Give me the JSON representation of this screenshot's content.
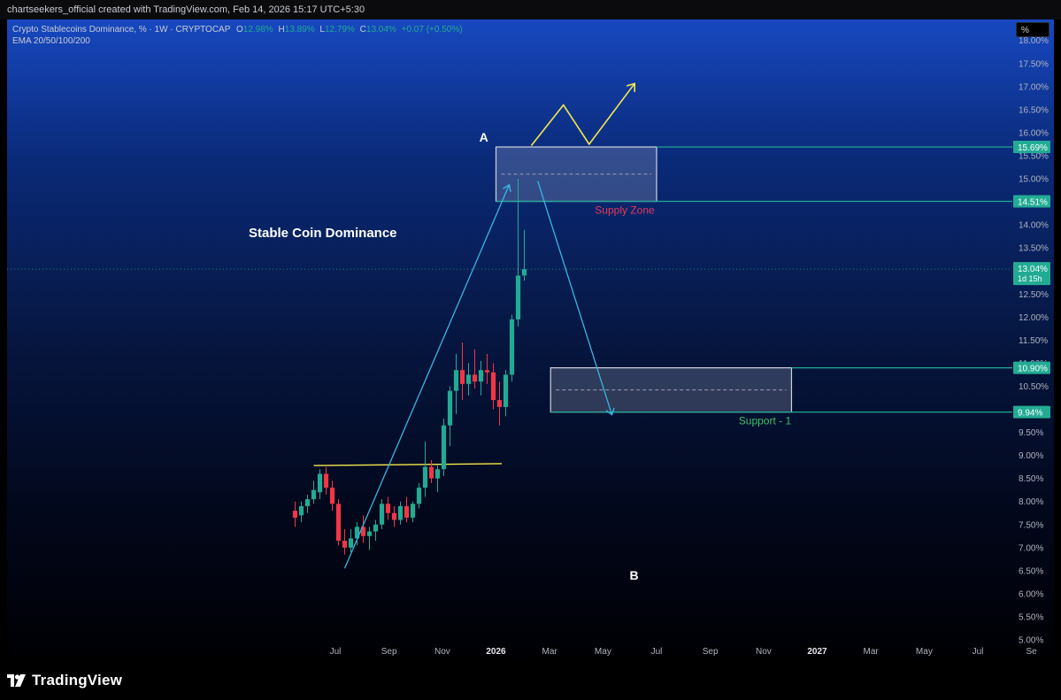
{
  "header": {
    "attribution": "chartseekers_official created with TradingView.com, Feb 14, 2026 15:17 UTC+5:30"
  },
  "legend": {
    "symbol": "Crypto Stablecoins Dominance, % · 1W · CRYPTOCAP",
    "o_label": "O",
    "o_value": "12.98%",
    "h_label": "H",
    "h_value": "13.89%",
    "l_label": "L",
    "l_value": "12.79%",
    "c_label": "C",
    "c_value": "13.04%",
    "change": "+0.07 (+0.50%)",
    "indicator": "EMA 20/50/100/200"
  },
  "scale_unit": "%",
  "brand": {
    "name": "TradingView"
  },
  "colors": {
    "up": "#22ab94",
    "down": "#f23645",
    "accent": "#22ab94",
    "arrow": "#38b6e0",
    "yellow": "#f5e94a"
  },
  "chart_data": {
    "type": "candlestick",
    "title": "Stable Coin Dominance",
    "ylim": [
      5.0,
      18.5
    ],
    "y_ticks": [
      "5.00%",
      "5.50%",
      "6.00%",
      "6.50%",
      "7.00%",
      "7.50%",
      "8.00%",
      "8.50%",
      "9.00%",
      "9.50%",
      "10.00%",
      "10.50%",
      "11.00%",
      "11.50%",
      "12.00%",
      "12.50%",
      "13.00%",
      "13.50%",
      "14.00%",
      "14.50%",
      "15.00%",
      "15.50%",
      "16.00%",
      "16.50%",
      "17.00%",
      "17.50%",
      "18.00%"
    ],
    "x_ticks": [
      {
        "label": "Jul",
        "t": 2025.5,
        "bold": false
      },
      {
        "label": "Sep",
        "t": 2025.667,
        "bold": false
      },
      {
        "label": "Nov",
        "t": 2025.833,
        "bold": false
      },
      {
        "label": "2026",
        "t": 2026.0,
        "bold": true
      },
      {
        "label": "Mar",
        "t": 2026.167,
        "bold": false
      },
      {
        "label": "May",
        "t": 2026.333,
        "bold": false
      },
      {
        "label": "Jul",
        "t": 2026.5,
        "bold": false
      },
      {
        "label": "Sep",
        "t": 2026.667,
        "bold": false
      },
      {
        "label": "Nov",
        "t": 2026.833,
        "bold": false
      },
      {
        "label": "2027",
        "t": 2027.0,
        "bold": true
      },
      {
        "label": "Mar",
        "t": 2027.167,
        "bold": false
      },
      {
        "label": "May",
        "t": 2027.333,
        "bold": false
      },
      {
        "label": "Jul",
        "t": 2027.5,
        "bold": false
      },
      {
        "label": "Se",
        "t": 2027.667,
        "bold": false
      }
    ],
    "candles": [
      {
        "o": 7.8,
        "h": 8.0,
        "l": 7.45,
        "c": 7.65
      },
      {
        "o": 7.7,
        "h": 8.0,
        "l": 7.55,
        "c": 7.9
      },
      {
        "o": 7.9,
        "h": 8.15,
        "l": 7.75,
        "c": 8.05
      },
      {
        "o": 8.05,
        "h": 8.45,
        "l": 7.95,
        "c": 8.25
      },
      {
        "o": 8.2,
        "h": 8.7,
        "l": 8.05,
        "c": 8.6
      },
      {
        "o": 8.6,
        "h": 8.75,
        "l": 8.15,
        "c": 8.3
      },
      {
        "o": 8.3,
        "h": 8.45,
        "l": 7.8,
        "c": 7.95
      },
      {
        "o": 7.95,
        "h": 8.05,
        "l": 7.05,
        "c": 7.15
      },
      {
        "o": 7.15,
        "h": 7.4,
        "l": 6.85,
        "c": 7.0
      },
      {
        "o": 7.0,
        "h": 7.4,
        "l": 6.9,
        "c": 7.2
      },
      {
        "o": 7.2,
        "h": 7.55,
        "l": 7.05,
        "c": 7.45
      },
      {
        "o": 7.45,
        "h": 7.7,
        "l": 7.1,
        "c": 7.25
      },
      {
        "o": 7.25,
        "h": 7.45,
        "l": 6.95,
        "c": 7.35
      },
      {
        "o": 7.35,
        "h": 7.6,
        "l": 7.15,
        "c": 7.5
      },
      {
        "o": 7.5,
        "h": 8.05,
        "l": 7.4,
        "c": 7.95
      },
      {
        "o": 7.95,
        "h": 8.1,
        "l": 7.6,
        "c": 7.75
      },
      {
        "o": 7.75,
        "h": 7.9,
        "l": 7.45,
        "c": 7.6
      },
      {
        "o": 7.6,
        "h": 8.0,
        "l": 7.5,
        "c": 7.9
      },
      {
        "o": 7.9,
        "h": 8.1,
        "l": 7.55,
        "c": 7.65
      },
      {
        "o": 7.65,
        "h": 8.0,
        "l": 7.55,
        "c": 7.95
      },
      {
        "o": 7.95,
        "h": 8.4,
        "l": 7.85,
        "c": 8.3
      },
      {
        "o": 8.3,
        "h": 9.3,
        "l": 8.1,
        "c": 8.75
      },
      {
        "o": 8.75,
        "h": 8.9,
        "l": 8.4,
        "c": 8.5
      },
      {
        "o": 8.5,
        "h": 8.8,
        "l": 8.2,
        "c": 8.7
      },
      {
        "o": 8.7,
        "h": 9.8,
        "l": 8.55,
        "c": 9.65
      },
      {
        "o": 9.65,
        "h": 10.5,
        "l": 9.2,
        "c": 10.4
      },
      {
        "o": 10.4,
        "h": 11.2,
        "l": 9.9,
        "c": 10.85
      },
      {
        "o": 10.85,
        "h": 11.45,
        "l": 10.2,
        "c": 10.55
      },
      {
        "o": 10.55,
        "h": 11.0,
        "l": 10.3,
        "c": 10.75
      },
      {
        "o": 10.75,
        "h": 11.3,
        "l": 10.45,
        "c": 10.6
      },
      {
        "o": 10.6,
        "h": 11.05,
        "l": 10.3,
        "c": 10.85
      },
      {
        "o": 10.85,
        "h": 11.2,
        "l": 10.55,
        "c": 10.8
      },
      {
        "o": 10.8,
        "h": 11.0,
        "l": 10.0,
        "c": 10.2
      },
      {
        "o": 10.2,
        "h": 10.6,
        "l": 9.65,
        "c": 10.05
      },
      {
        "o": 10.05,
        "h": 10.85,
        "l": 9.85,
        "c": 10.75
      },
      {
        "o": 10.75,
        "h": 12.05,
        "l": 10.6,
        "c": 11.95
      },
      {
        "o": 11.95,
        "h": 15.0,
        "l": 11.8,
        "c": 12.9
      },
      {
        "o": 12.9,
        "h": 13.89,
        "l": 12.79,
        "c": 13.04
      }
    ],
    "horizontal_line": {
      "from_index": 3,
      "to_index": 20.5,
      "y_start": 8.78,
      "y_end": 8.82
    },
    "zones": [
      {
        "label": "Supply Zone",
        "top": 15.69,
        "bottom": 14.51,
        "from_t": 2026.0,
        "to_t": 2026.5,
        "line_to_t": 2027.667,
        "top_tag": "15.69%",
        "bottom_tag": "14.51%"
      },
      {
        "label": "Support - 1",
        "top": 10.9,
        "bottom": 9.94,
        "from_t": 2026.17,
        "to_t": 2026.92,
        "line_to_t": 2027.667,
        "top_tag": "10.90%",
        "bottom_tag": "9.94%"
      }
    ],
    "current_price": {
      "value_label": "13.04%",
      "countdown": "1d 15h",
      "value": 13.04
    },
    "points": [
      {
        "label": "A",
        "t": 2025.962,
        "y": 15.9
      },
      {
        "label": "B",
        "t": 2026.43,
        "y": 6.4
      }
    ]
  }
}
